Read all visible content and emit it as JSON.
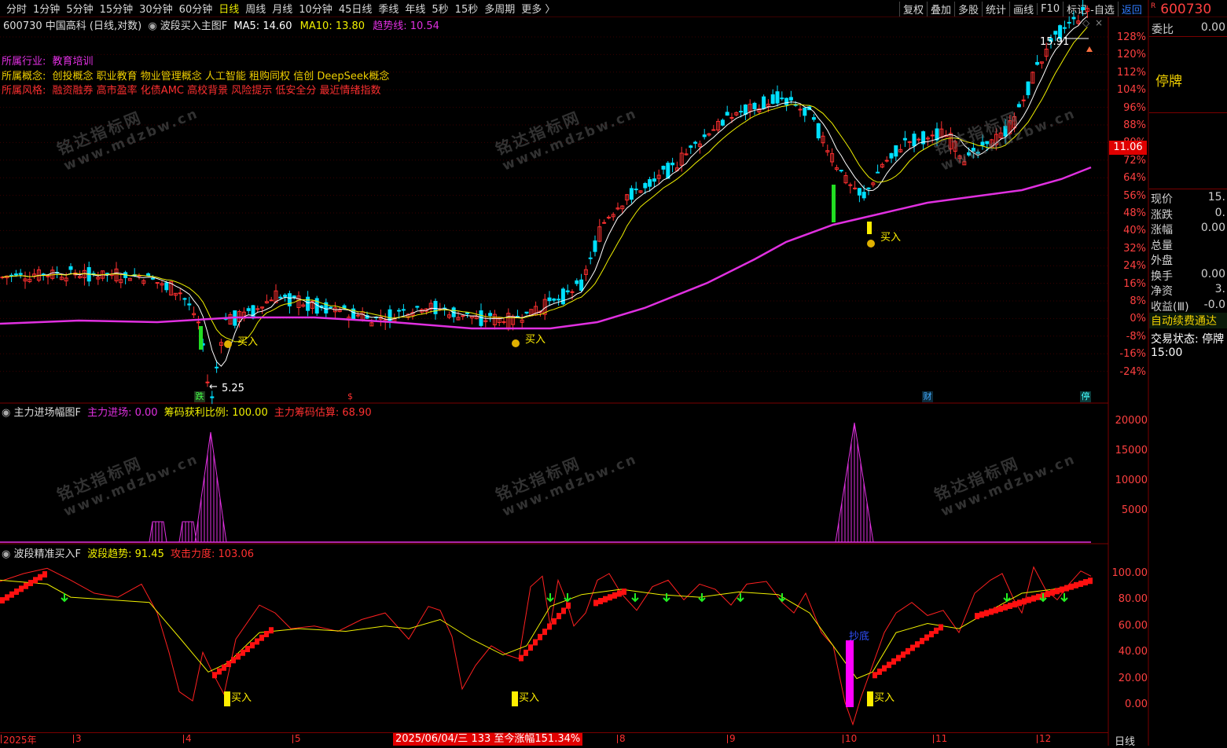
{
  "toolbar": {
    "periods": [
      "分时",
      "1分钟",
      "5分钟",
      "15分钟",
      "30分钟",
      "60分钟",
      "日线",
      "周线",
      "月线",
      "10分钟",
      "45日线",
      "季线",
      "年线",
      "5秒",
      "15秒",
      "多周期",
      "更多 〉"
    ],
    "active_period": "日线",
    "buttons": [
      "复权",
      "叠加",
      "多股",
      "统计",
      "画线",
      "F10",
      "标记"
    ],
    "self_select": "-自选",
    "back": "返回"
  },
  "quote": {
    "code": "600730",
    "badge": "R"
  },
  "main_header": {
    "stock": "600730 中国高科 (日线,对数)",
    "indicator_name": "波段买入主图F",
    "ma5": "MA5: 14.60",
    "ma10": "MA10: 13.80",
    "trend": "趋势线: 10.54"
  },
  "info": {
    "industry_label": "所属行业:",
    "industry": "教育培训",
    "concept_label": "所属概念:",
    "concepts": "创投概念 职业教育 物业管理概念 人工智能 租购同权 信创 DeepSeek概念",
    "style_label": "所属风格:",
    "styles": "融资融券 高市盈率 化债AMC 高校背景 风险提示 低安全分 最近情绪指数"
  },
  "price_axis": [
    "128%",
    "120%",
    "112%",
    "104%",
    "96%",
    "88%",
    "80%",
    "72%",
    "64%",
    "56%",
    "48%",
    "40%",
    "32%",
    "24%",
    "16%",
    "8%",
    "0%",
    "-8%",
    "-16%",
    "-24%"
  ],
  "current_price_tag": "11.06",
  "annotations": {
    "high": "15.91",
    "low": "5.25",
    "buy": "买入",
    "tag_die": "跌",
    "tag_s": "$",
    "tag_cai": "财",
    "tag_ting": "停"
  },
  "right_panel": {
    "weibi_label": "委比",
    "weibi_value": "0.00",
    "status": "停牌",
    "rows": [
      {
        "label": "现价",
        "value": "15."
      },
      {
        "label": "涨跌",
        "value": "0."
      },
      {
        "label": "涨幅",
        "value": "0.00"
      },
      {
        "label": "总量",
        "value": ""
      },
      {
        "label": "外盘",
        "value": ""
      },
      {
        "label": "换手",
        "value": "0.00"
      },
      {
        "label": "净资",
        "value": "3."
      },
      {
        "label": "收益(Ⅲ)",
        "value": "-0.0"
      }
    ],
    "auto_renew": "自动续费通达",
    "trade_state": "交易状态: 停牌",
    "time": "15:00"
  },
  "panel2": {
    "name": "主力进场幅图F",
    "main_in": "主力进场: 0.00",
    "chip_ratio": "筹码获利比例: 100.00",
    "chip_est": "主力筹码估算: 68.90",
    "axis": [
      "20000",
      "15000",
      "10000",
      "5000"
    ]
  },
  "panel3": {
    "name": "波段精准买入F",
    "trend": "波段趋势: 91.45",
    "attack": "攻击力度: 103.06",
    "axis": [
      "100.00",
      "80.00",
      "60.00",
      "40.00",
      "20.00",
      "0.00"
    ],
    "bottom_label": "抄底"
  },
  "bottom": {
    "months": [
      "2025年",
      "3",
      "4",
      "5",
      "8",
      "9",
      "10",
      "11",
      "12"
    ],
    "date_label": "2025/06/04/三 133 至今涨幅151.34%",
    "period": "日线"
  },
  "watermark": {
    "line1": "铭达指标网",
    "line2": "www.mdzbw.cn"
  },
  "colors": {
    "up": "#ff3030",
    "down": "#00e0ff",
    "trend": "#e030e0",
    "ma5": "#ffffff",
    "ma10": "#f0f000",
    "buy": "#ffee00",
    "bg": "#000000"
  }
}
